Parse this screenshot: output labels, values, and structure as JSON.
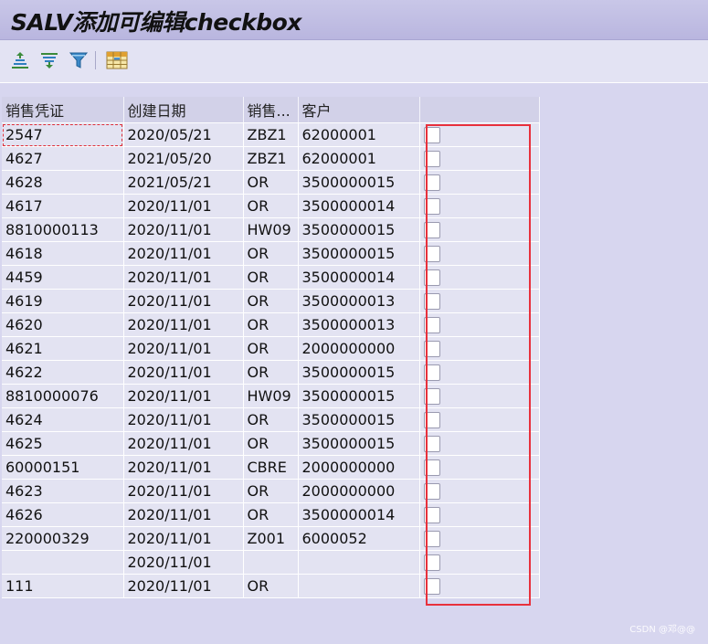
{
  "title": "SALV添加可编辑checkbox",
  "toolbar": {
    "buttons": [
      {
        "name": "sort-ascending-icon"
      },
      {
        "name": "sort-descending-icon"
      },
      {
        "name": "filter-icon"
      },
      {
        "name": "layout-grid-icon"
      }
    ]
  },
  "grid": {
    "headers": [
      "销售凭证",
      "创建日期",
      "销售...",
      "客户",
      ""
    ],
    "rows": [
      {
        "doc": "2547",
        "date": "2020/05/21",
        "sales": "ZBZ1",
        "customer": "62000001",
        "checked": false
      },
      {
        "doc": "4627",
        "date": "2021/05/20",
        "sales": "ZBZ1",
        "customer": "62000001",
        "checked": false
      },
      {
        "doc": "4628",
        "date": "2021/05/21",
        "sales": "OR",
        "customer": "3500000015",
        "checked": false
      },
      {
        "doc": "4617",
        "date": "2020/11/01",
        "sales": "OR",
        "customer": "3500000014",
        "checked": false
      },
      {
        "doc": "8810000113",
        "date": "2020/11/01",
        "sales": "HW09",
        "customer": "3500000015",
        "checked": false
      },
      {
        "doc": "4618",
        "date": "2020/11/01",
        "sales": "OR",
        "customer": "3500000015",
        "checked": false
      },
      {
        "doc": "4459",
        "date": "2020/11/01",
        "sales": "OR",
        "customer": "3500000014",
        "checked": false
      },
      {
        "doc": "4619",
        "date": "2020/11/01",
        "sales": "OR",
        "customer": "3500000013",
        "checked": false
      },
      {
        "doc": "4620",
        "date": "2020/11/01",
        "sales": "OR",
        "customer": "3500000013",
        "checked": false
      },
      {
        "doc": "4621",
        "date": "2020/11/01",
        "sales": "OR",
        "customer": "2000000000",
        "checked": false
      },
      {
        "doc": "4622",
        "date": "2020/11/01",
        "sales": "OR",
        "customer": "3500000015",
        "checked": false
      },
      {
        "doc": "8810000076",
        "date": "2020/11/01",
        "sales": "HW09",
        "customer": "3500000015",
        "checked": false
      },
      {
        "doc": "4624",
        "date": "2020/11/01",
        "sales": "OR",
        "customer": "3500000015",
        "checked": false
      },
      {
        "doc": "4625",
        "date": "2020/11/01",
        "sales": "OR",
        "customer": "3500000015",
        "checked": false
      },
      {
        "doc": "60000151",
        "date": "2020/11/01",
        "sales": "CBRE",
        "customer": "2000000000",
        "checked": false
      },
      {
        "doc": "4623",
        "date": "2020/11/01",
        "sales": "OR",
        "customer": "2000000000",
        "checked": false
      },
      {
        "doc": "4626",
        "date": "2020/11/01",
        "sales": "OR",
        "customer": "3500000014",
        "checked": false
      },
      {
        "doc": "220000329",
        "date": "2020/11/01",
        "sales": "Z001",
        "customer": "6000052",
        "checked": false
      },
      {
        "doc": "",
        "date": "2020/11/01",
        "sales": "",
        "customer": "",
        "checked": false
      },
      {
        "doc": "111",
        "date": "2020/11/01",
        "sales": "OR",
        "customer": "",
        "checked": false
      }
    ]
  },
  "watermark": "CSDN @邓@@",
  "colors": {
    "highlight_box": "#e8313c",
    "selected_cell": "#fff4a8",
    "title_bar": "#c9c7e8",
    "grid_cell": "#e3e3f2"
  }
}
